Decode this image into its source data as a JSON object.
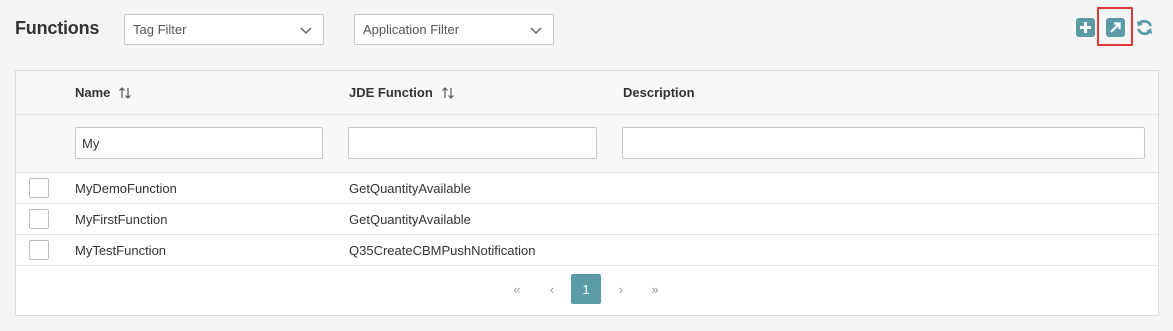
{
  "title": "Functions",
  "filters": {
    "tag": "Tag Filter",
    "application": "Application Filter"
  },
  "toolbar": {
    "add": "plus-icon",
    "export": "external-link-icon",
    "refresh": "refresh-icon"
  },
  "table": {
    "columns": [
      "Name",
      "JDE Function",
      "Description"
    ],
    "column_filters": [
      "My",
      "",
      ""
    ],
    "rows": [
      {
        "name": "MyDemoFunction",
        "jde_function": "GetQuantityAvailable",
        "description": ""
      },
      {
        "name": "MyFirstFunction",
        "jde_function": "GetQuantityAvailable",
        "description": ""
      },
      {
        "name": "MyTestFunction",
        "jde_function": "Q35CreateCBMPushNotification",
        "description": ""
      }
    ]
  },
  "pagination": {
    "first": "«",
    "prev": "‹",
    "current_page": "1",
    "next": "›",
    "last": "»"
  },
  "colors": {
    "accent": "#5a9ba5",
    "highlight_border": "#e0393b"
  }
}
